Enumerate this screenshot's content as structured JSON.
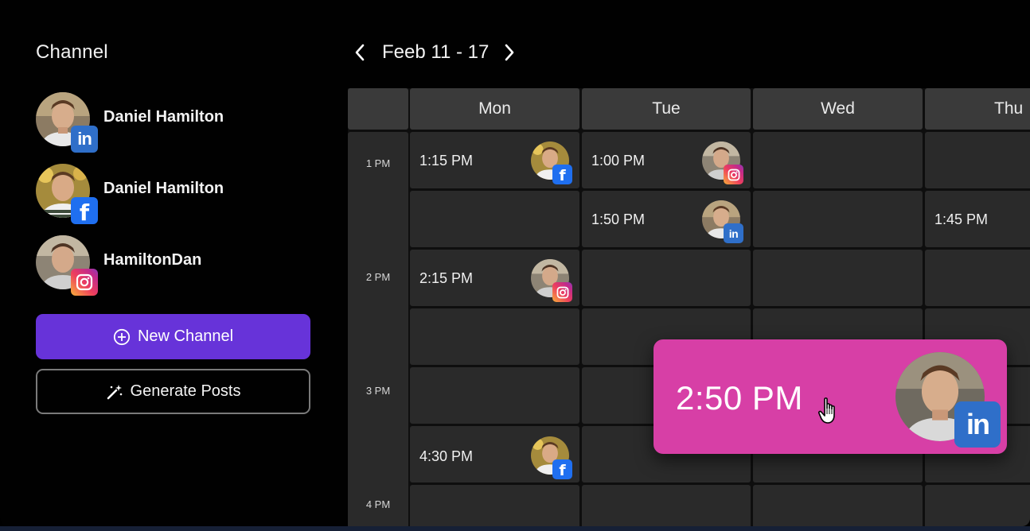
{
  "sidebar": {
    "title": "Channel",
    "channels": [
      {
        "name": "Daniel Hamilton",
        "network": "linkedin",
        "badge_text": "in"
      },
      {
        "name": "Daniel Hamilton",
        "network": "facebook",
        "badge_text": "f"
      },
      {
        "name": "HamiltonDan",
        "network": "instagram",
        "badge_text": ""
      }
    ],
    "new_channel_label": "New Channel",
    "new_channel_icon": "plus-circle-icon",
    "generate_posts_label": "Generate Posts",
    "generate_posts_icon": "magic-wand-icon"
  },
  "week_nav": {
    "label": "Feeb 11 - 17",
    "prev_icon": "chevron-left-icon",
    "next_icon": "chevron-right-icon"
  },
  "calendar": {
    "days": [
      "Mon",
      "Tue",
      "Wed",
      "Thu"
    ],
    "time_labels": [
      "1 PM",
      "2 PM",
      "3 PM",
      "4 PM"
    ],
    "posts": [
      {
        "day": "Mon",
        "time": "1:15 PM",
        "network": "facebook",
        "badge_text": "f"
      },
      {
        "day": "Tue",
        "time": "1:00 PM",
        "network": "instagram",
        "badge_text": ""
      },
      {
        "day": "Tue",
        "time": "1:50 PM",
        "network": "linkedin",
        "badge_text": "in"
      },
      {
        "day": "Thu",
        "time": "1:45 PM",
        "network": "none",
        "badge_text": ""
      },
      {
        "day": "Mon",
        "time": "2:15 PM",
        "network": "instagram",
        "badge_text": ""
      },
      {
        "day": "Mon",
        "time": "4:30 PM",
        "network": "facebook",
        "badge_text": "f"
      }
    ],
    "dragging_post": {
      "time": "2:50 PM",
      "network": "linkedin",
      "badge_text": "in"
    }
  },
  "colors": {
    "primary_button": "#6733d9",
    "drag_card": "#d73fa6",
    "linkedin": "#2f6fc9",
    "facebook": "#1f6ff0"
  }
}
